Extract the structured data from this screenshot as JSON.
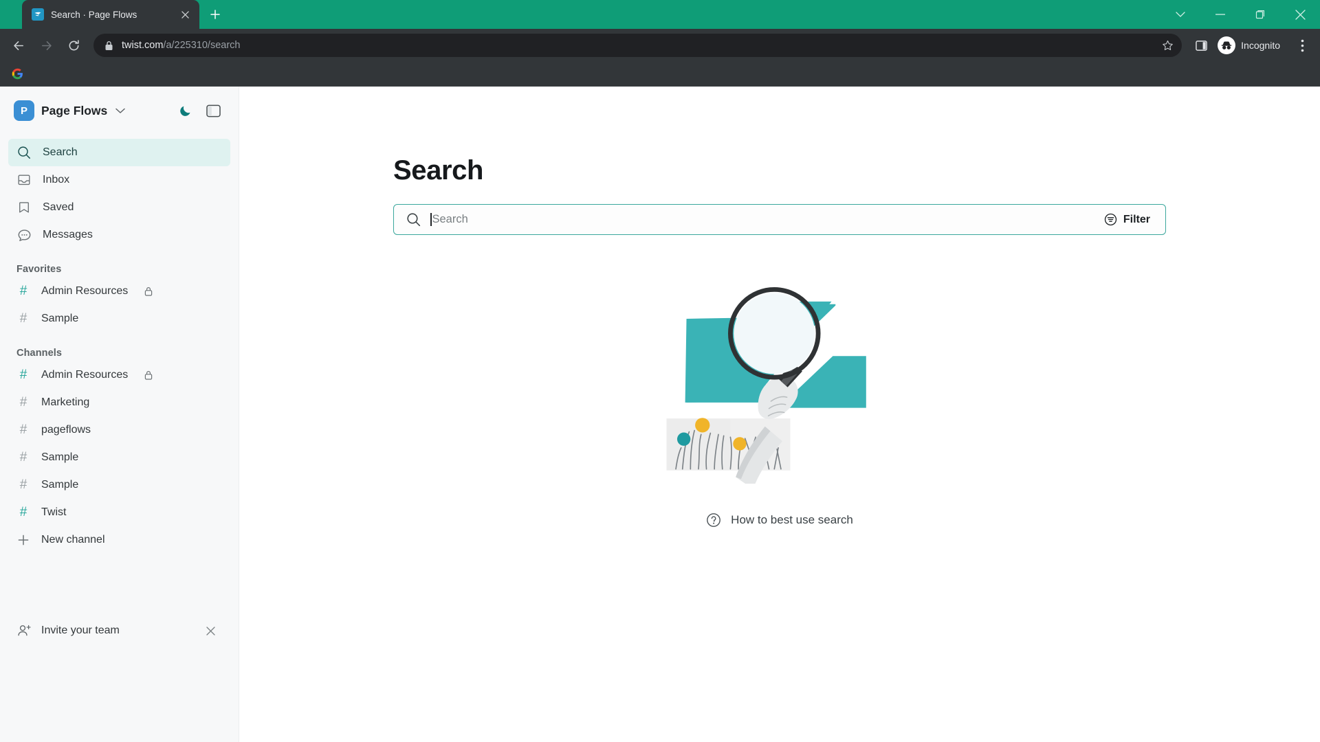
{
  "browser": {
    "tab": {
      "title": "Search · Page Flows",
      "favicon": "twist-icon",
      "close_label": "✕"
    },
    "new_tab_label": "+",
    "window_controls": {
      "minimize_tabs_label": "chevron-down-icon",
      "minimize_label": "minimize-icon",
      "maximize_label": "maximize-icon",
      "close_label": "close-icon"
    },
    "nav": {
      "back_label": "back-icon",
      "forward_label": "forward-icon",
      "reload_label": "reload-icon"
    },
    "omnibox": {
      "host": "twist.com",
      "path": "/a/225310/search",
      "lock_icon": "lock-icon",
      "bookmark_icon": "star-icon"
    },
    "side_panel_label": "side-panel-icon",
    "profile": {
      "label": "Incognito",
      "icon": "incognito-icon"
    },
    "menu_label": "three-dot-menu-icon",
    "bookmarks": [
      {
        "name": "google-bookmark",
        "icon": "google-icon"
      }
    ]
  },
  "sidebar": {
    "workspace": {
      "initial": "P",
      "name": "Page Flows",
      "caret": "chevron-down-icon",
      "theme_toggle": "moon-icon",
      "panel_toggle": "panel-toggle-icon"
    },
    "nav_items": [
      {
        "label": "Search",
        "icon": "search-icon",
        "active": true
      },
      {
        "label": "Inbox",
        "icon": "inbox-icon",
        "active": false
      },
      {
        "label": "Saved",
        "icon": "bookmark-icon",
        "active": false
      },
      {
        "label": "Messages",
        "icon": "messages-icon",
        "active": false
      }
    ],
    "favorites_title": "Favorites",
    "favorites": [
      {
        "label": "Admin Resources",
        "hash_color": "teal",
        "private": true
      },
      {
        "label": "Sample",
        "hash_color": "gray",
        "private": false
      }
    ],
    "channels_title": "Channels",
    "channels": [
      {
        "label": "Admin Resources",
        "hash_color": "teal",
        "private": true
      },
      {
        "label": "Marketing",
        "hash_color": "gray",
        "private": false
      },
      {
        "label": "pageflows",
        "hash_color": "gray",
        "private": false
      },
      {
        "label": "Sample",
        "hash_color": "gray",
        "private": false
      },
      {
        "label": "Sample",
        "hash_color": "gray",
        "private": false
      },
      {
        "label": "Twist",
        "hash_color": "teal",
        "private": false
      }
    ],
    "new_channel": {
      "label": "New channel",
      "icon": "plus-icon"
    },
    "invite": {
      "label": "Invite your team",
      "icon": "add-person-icon",
      "dismiss": "✕"
    }
  },
  "main": {
    "title": "Search",
    "search": {
      "value": "",
      "placeholder": "Search",
      "icon": "search-icon"
    },
    "filter": {
      "label": "Filter",
      "icon": "filter-icon"
    },
    "illustration": "magnifying-glass-hand-illustration",
    "help": {
      "label": "How to best use search",
      "icon": "question-circle-icon"
    }
  },
  "colors": {
    "brand_teal": "#0f9d77",
    "accent_teal": "#2aa79c",
    "illustration_teal": "#34b5b8",
    "illustration_yellow": "#f0b429",
    "chrome_dark": "#323639",
    "sidebar_bg": "#f7f8f9",
    "active_nav_bg": "#dff2f0"
  }
}
